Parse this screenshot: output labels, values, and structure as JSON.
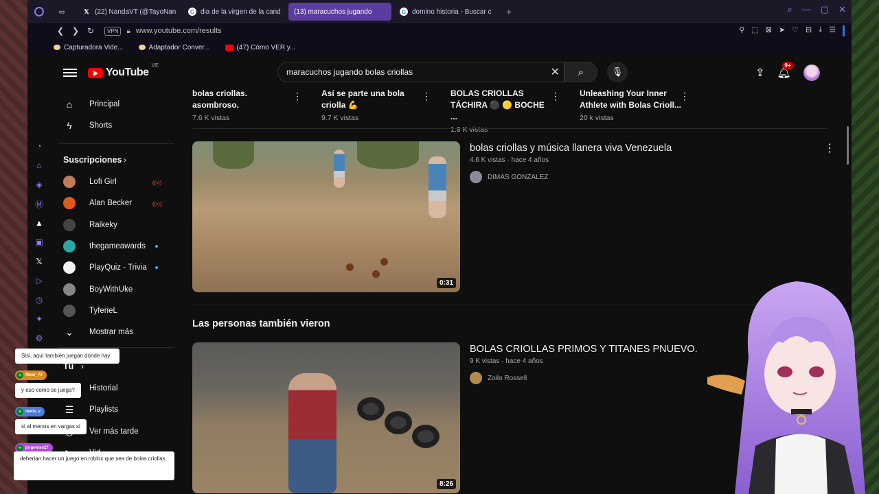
{
  "browser": {
    "tabs": [
      {
        "label": "",
        "icon": "x-icon"
      },
      {
        "label": "(22) NandaVT (@TayoNan",
        "icon": "x-icon"
      },
      {
        "label": "dia de la virgen de la cand",
        "icon": "google-icon"
      },
      {
        "label": "(13) maracuchos jugando",
        "icon": "youtube-icon",
        "active": true
      },
      {
        "label": "domino historia - Buscar c",
        "icon": "google-icon"
      }
    ],
    "new_tab": "+",
    "vpn": "VPN",
    "url": "www.youtube.com/results",
    "bookmarks": [
      {
        "label": "Capturadora Vide...",
        "icon": "bookmark-icon"
      },
      {
        "label": "Adaptador Conver...",
        "icon": "bookmark-icon"
      },
      {
        "label": "(47) Cómo VER y...",
        "icon": "youtube-icon"
      }
    ],
    "accent": "#8a7df0",
    "active_tab_color": "#5b3d9f"
  },
  "youtube": {
    "logo_text": "YouTube",
    "country_code": "VE",
    "search_value": "maracuchos jugando bolas criollas",
    "notification_badge": "9+",
    "sidebar": {
      "nav": [
        {
          "label": "Principal",
          "icon": "home-icon"
        },
        {
          "label": "Shorts",
          "icon": "shorts-icon"
        }
      ],
      "subscriptions_heading": "Suscripciones",
      "subscriptions": [
        {
          "label": "Lofi Girl",
          "status": "live",
          "color": "#c27b5a"
        },
        {
          "label": "Alan Becker",
          "status": "live",
          "color": "#e05a1a"
        },
        {
          "label": "Raikeky",
          "status": "",
          "color": "#444"
        },
        {
          "label": "thegameawards",
          "status": "new",
          "color": "#2aa7a0"
        },
        {
          "label": "PlayQuiz - Trivia",
          "status": "new",
          "color": "#f2f2f2"
        },
        {
          "label": "BoyWithUke",
          "status": "",
          "color": "#888"
        },
        {
          "label": "TyferieL",
          "status": "",
          "color": "#555"
        }
      ],
      "show_more": "Mostrar más",
      "you_heading": "Tú",
      "you_items": [
        {
          "label": "Historial",
          "icon": "history-icon"
        },
        {
          "label": "Playlists",
          "icon": "playlist-icon"
        },
        {
          "label": "Ver más tarde",
          "icon": "clock-icon"
        },
        {
          "label": "Vid...",
          "icon": "video-icon"
        }
      ]
    },
    "shorts_row": [
      {
        "title": "bolas criollas. asombroso.",
        "views": "7.6 K vistas"
      },
      {
        "title": "Así se parte una bola criolla 💪",
        "views": "9.7 K vistas"
      },
      {
        "title": "BOLAS CRIOLLAS TÁCHIRA ⚫ 🟡 BOCHE ...",
        "views": "1.8 K vistas"
      },
      {
        "title": "Unleashing Your Inner Athlete with Bolas Crioll...",
        "views": "20 k vistas"
      }
    ],
    "videos": [
      {
        "title": "bolas criollas y música llanera viva Venezuela",
        "meta": "4.6 K vistas · hace 4 años",
        "channel": "DIMAS GONZALEZ",
        "duration": "0:31"
      }
    ],
    "section_title": "Las personas también vieron",
    "related": [
      {
        "title": "BOLAS CRIOLLAS PRIMOS Y TITANES PNUEVO.",
        "meta": "9 K vistas · hace 4 años",
        "channel": "Zoilo Rossell",
        "duration": "8:26"
      }
    ]
  },
  "chat": [
    {
      "user": "",
      "message": "Sisi, aquí también juegan dónde hay"
    },
    {
      "user": "ffleer_73",
      "message": "y eso como se juega?"
    },
    {
      "user": "malia_v",
      "message": "si al menos en vargas si"
    },
    {
      "user": "jorgeloso27",
      "message": "deberian hacer un juego en roblox que sea de bolas criollas"
    }
  ]
}
